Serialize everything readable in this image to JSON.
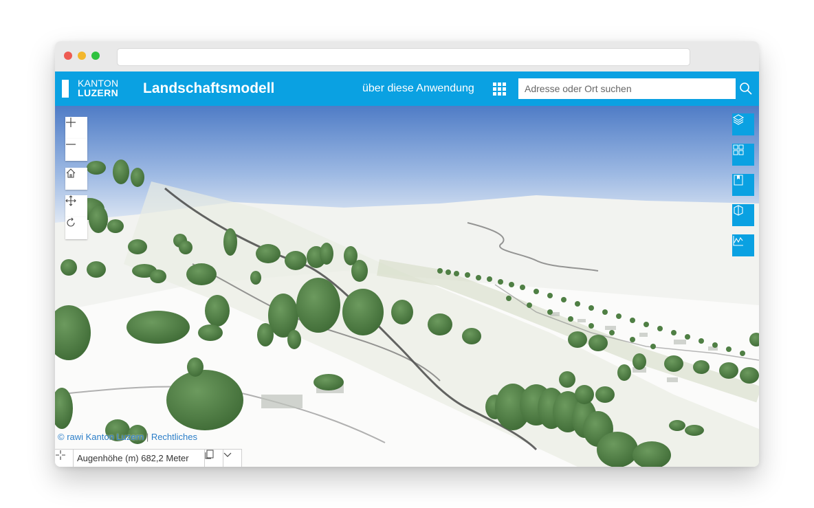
{
  "app": {
    "logo_line1": "KANTON",
    "logo_line2": "LUZERN",
    "title": "Landschaftsmodell",
    "about_link": "über diese Anwendung",
    "search_placeholder": "Adresse oder Ort suchen"
  },
  "attribution": {
    "copyright": "© rawi Kanton Luzern",
    "separator": " | ",
    "legal_link": "Rechtliches"
  },
  "status": {
    "eye_height_label": "Augenhöhe (m) 682,2 Meter"
  },
  "colors": {
    "accent": "#0aa1e2",
    "tree": "#4f7f44"
  },
  "icons": {
    "zoom_in": "plus-icon",
    "zoom_out": "minus-icon",
    "home": "home-icon",
    "pan": "pan-icon",
    "rotate": "rotate-icon",
    "layers": "layers-icon",
    "basemap": "basemap-gallery-icon",
    "bookmarks": "bookmark-icon",
    "slice": "slice-icon",
    "elevation_profile": "elevation-profile-icon",
    "search": "search-icon",
    "app_launcher": "grid-icon"
  }
}
